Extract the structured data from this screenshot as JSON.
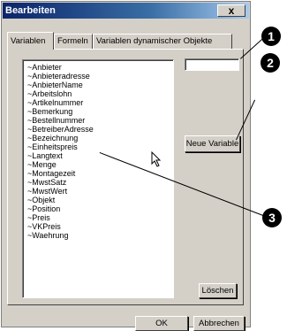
{
  "window": {
    "title": "Bearbeiten",
    "close_glyph": "x"
  },
  "tabs": [
    {
      "label": "Variablen"
    },
    {
      "label": "Formeln"
    },
    {
      "label": "Variablen dynamischer Objekte"
    }
  ],
  "variables": [
    "~Anbieter",
    "~Anbieteradresse",
    "~AnbieterName",
    "~Arbeitslohn",
    "~Artikelnummer",
    "~Bemerkung",
    "~Bestellnummer",
    "~BetreiberAdresse",
    "~Bezeichnung",
    "~Einheitspreis",
    "~Langtext",
    "~Menge",
    "~Montagezeit",
    "~MwstSatz",
    "~MwstWert",
    "~Objekt",
    "~Position",
    "~Preis",
    "~VKPreis",
    "~Waehrung"
  ],
  "variable_name_input": {
    "value": ""
  },
  "buttons": {
    "new_variable": "Neue Variable",
    "delete": "Löschen",
    "ok": "OK",
    "cancel": "Abbrechen"
  },
  "callouts": [
    "1",
    "2",
    "3"
  ]
}
